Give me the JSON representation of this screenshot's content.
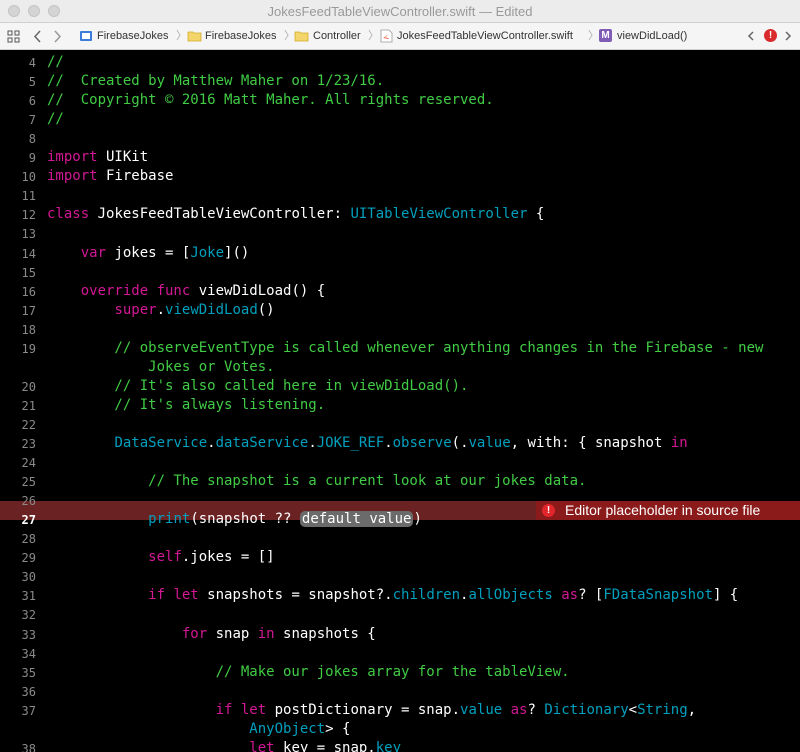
{
  "window": {
    "title": "JokesFeedTableViewController.swift — Edited"
  },
  "jumpbar": {
    "items": [
      {
        "label": "FirebaseJokes",
        "icon": "project-icon"
      },
      {
        "label": "FirebaseJokes",
        "icon": "folder-icon"
      },
      {
        "label": "Controller",
        "icon": "folder-icon"
      },
      {
        "label": "JokesFeedTableViewController.swift",
        "icon": "swift-file-icon"
      },
      {
        "label": "viewDidLoad()",
        "icon": "method-icon"
      }
    ],
    "method_badge": "M"
  },
  "editor": {
    "error_message": "Editor placeholder in source file",
    "current_line": "27",
    "lines": [
      {
        "n": "4",
        "parts": [
          [
            "cm",
            "//"
          ]
        ]
      },
      {
        "n": "5",
        "parts": [
          [
            "cm",
            "//  Created by Matthew Maher on 1/23/16."
          ]
        ]
      },
      {
        "n": "6",
        "parts": [
          [
            "cm",
            "//  Copyright © 2016 Matt Maher. All rights reserved."
          ]
        ]
      },
      {
        "n": "7",
        "parts": [
          [
            "cm",
            "//"
          ]
        ]
      },
      {
        "n": "8",
        "parts": []
      },
      {
        "n": "9",
        "parts": [
          [
            "kw",
            "import"
          ],
          [
            "pl",
            " UIKit"
          ]
        ]
      },
      {
        "n": "10",
        "parts": [
          [
            "kw",
            "import"
          ],
          [
            "pl",
            " Firebase"
          ]
        ]
      },
      {
        "n": "11",
        "parts": []
      },
      {
        "n": "12",
        "parts": [
          [
            "kw",
            "class"
          ],
          [
            "pl",
            " JokesFeedTableViewController: "
          ],
          [
            "ty",
            "UITableViewController"
          ],
          [
            "pl",
            " {"
          ]
        ]
      },
      {
        "n": "13",
        "parts": []
      },
      {
        "n": "14",
        "parts": [
          [
            "pl",
            "    "
          ],
          [
            "kw",
            "var"
          ],
          [
            "pl",
            " jokes = ["
          ],
          [
            "ty",
            "Joke"
          ],
          [
            "pl",
            "]()"
          ]
        ]
      },
      {
        "n": "15",
        "parts": []
      },
      {
        "n": "16",
        "parts": [
          [
            "pl",
            "    "
          ],
          [
            "kw",
            "override func"
          ],
          [
            "pl",
            " viewDidLoad() {"
          ]
        ]
      },
      {
        "n": "17",
        "parts": [
          [
            "pl",
            "        "
          ],
          [
            "kw",
            "super"
          ],
          [
            "pl",
            "."
          ],
          [
            "sy",
            "viewDidLoad"
          ],
          [
            "pl",
            "()"
          ]
        ]
      },
      {
        "n": "18",
        "parts": []
      },
      {
        "n": "19",
        "parts": [
          [
            "cm",
            "        // observeEventType is called whenever anything changes in the Firebase - new"
          ]
        ]
      },
      {
        "n": "",
        "parts": [
          [
            "cm",
            "            Jokes or Votes."
          ]
        ]
      },
      {
        "n": "20",
        "parts": [
          [
            "cm",
            "        // It's also called here in viewDidLoad()."
          ]
        ]
      },
      {
        "n": "21",
        "parts": [
          [
            "cm",
            "        // It's always listening."
          ]
        ]
      },
      {
        "n": "22",
        "parts": []
      },
      {
        "n": "23",
        "parts": [
          [
            "pl",
            "        "
          ],
          [
            "ty",
            "DataService"
          ],
          [
            "pl",
            "."
          ],
          [
            "sy",
            "dataService"
          ],
          [
            "pl",
            "."
          ],
          [
            "sy",
            "JOKE_REF"
          ],
          [
            "pl",
            "."
          ],
          [
            "sy",
            "observe"
          ],
          [
            "pl",
            "(."
          ],
          [
            "sy",
            "value"
          ],
          [
            "pl",
            ", with: { snapshot "
          ],
          [
            "kw",
            "in"
          ]
        ]
      },
      {
        "n": "24",
        "parts": []
      },
      {
        "n": "25",
        "parts": [
          [
            "cm",
            "            // The snapshot is a current look at our jokes data."
          ]
        ]
      },
      {
        "n": "26",
        "parts": []
      },
      {
        "n": "27",
        "parts": [
          [
            "pl",
            "            "
          ],
          [
            "sy",
            "print"
          ],
          [
            "pl",
            "(snapshot ?? "
          ],
          [
            "ph",
            "default value"
          ],
          [
            "pl",
            ")"
          ]
        ]
      },
      {
        "n": "28",
        "parts": []
      },
      {
        "n": "29",
        "parts": [
          [
            "pl",
            "            "
          ],
          [
            "kw",
            "self"
          ],
          [
            "pl",
            ".jokes = []"
          ]
        ]
      },
      {
        "n": "30",
        "parts": []
      },
      {
        "n": "31",
        "parts": [
          [
            "pl",
            "            "
          ],
          [
            "kw",
            "if let"
          ],
          [
            "pl",
            " snapshots = snapshot?."
          ],
          [
            "sy",
            "children"
          ],
          [
            "pl",
            "."
          ],
          [
            "sy",
            "allObjects"
          ],
          [
            "pl",
            " "
          ],
          [
            "kw",
            "as"
          ],
          [
            "pl",
            "? ["
          ],
          [
            "ty",
            "FDataSnapshot"
          ],
          [
            "pl",
            "] {"
          ]
        ]
      },
      {
        "n": "32",
        "parts": []
      },
      {
        "n": "33",
        "parts": [
          [
            "pl",
            "                "
          ],
          [
            "kw",
            "for"
          ],
          [
            "pl",
            " snap "
          ],
          [
            "kw",
            "in"
          ],
          [
            "pl",
            " snapshots {"
          ]
        ]
      },
      {
        "n": "34",
        "parts": []
      },
      {
        "n": "35",
        "parts": [
          [
            "cm",
            "                    // Make our jokes array for the tableView."
          ]
        ]
      },
      {
        "n": "36",
        "parts": []
      },
      {
        "n": "37",
        "parts": [
          [
            "pl",
            "                    "
          ],
          [
            "kw",
            "if let"
          ],
          [
            "pl",
            " postDictionary = snap."
          ],
          [
            "sy",
            "value"
          ],
          [
            "pl",
            " "
          ],
          [
            "kw",
            "as"
          ],
          [
            "pl",
            "? "
          ],
          [
            "ty",
            "Dictionary"
          ],
          [
            "pl",
            "<"
          ],
          [
            "ty",
            "String"
          ],
          [
            "pl",
            ","
          ]
        ]
      },
      {
        "n": "",
        "parts": [
          [
            "pl",
            "                        "
          ],
          [
            "ty",
            "AnyObject"
          ],
          [
            "pl",
            "> {"
          ]
        ]
      },
      {
        "n": "38",
        "parts": [
          [
            "pl",
            "                        "
          ],
          [
            "kw",
            "let"
          ],
          [
            "pl",
            " key = snap."
          ],
          [
            "sy",
            "key"
          ]
        ]
      }
    ]
  }
}
